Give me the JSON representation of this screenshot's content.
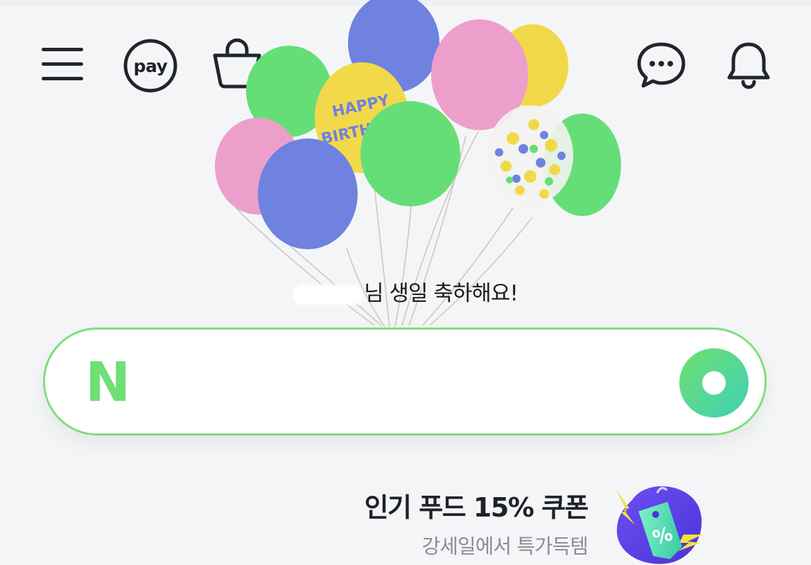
{
  "header": {
    "menu_icon": "hamburger-menu-icon",
    "pay_label": "pay",
    "shopping_icon": "shopping-bag-icon",
    "chat_icon": "chat-bubble-icon",
    "notification_icon": "bell-icon"
  },
  "greeting": {
    "text": "님 생일 축하해요!"
  },
  "search": {
    "logo_text": "N",
    "value": "",
    "placeholder": "",
    "action_icon": "green-ring-icon"
  },
  "promo": {
    "title": "인기 푸드 15% 쿠폰",
    "subtitle": "강세일에서 특가득템",
    "tag_symbol": "%"
  },
  "colors": {
    "background": "#f4f5f7",
    "brand_green": "#6fdf76",
    "text_dark": "#1f2226",
    "text_gray": "#8a8e94"
  }
}
